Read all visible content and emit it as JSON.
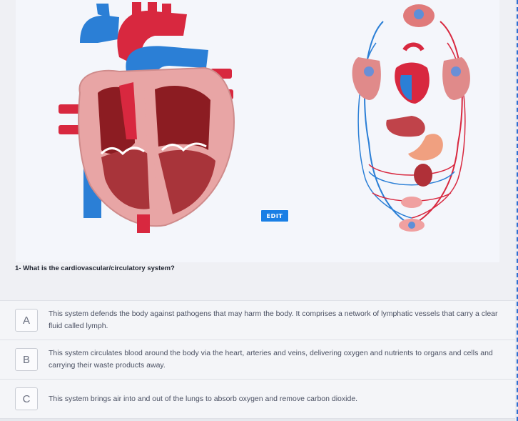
{
  "edit_button": "EDIT",
  "question": "1- What is the cardiovascular/circulatory system?",
  "options": [
    {
      "letter": "A",
      "text": "This system defends the body against pathogens that may harm the body. It comprises a network of lymphatic vessels that carry a clear fluid called lymph."
    },
    {
      "letter": "B",
      "text": "This system circulates blood around the body via the heart, arteries and veins, delivering oxygen and nutrients to organs and cells and carrying their waste products away."
    },
    {
      "letter": "C",
      "text": "This system brings air into and out of the lungs to absorb oxygen and remove carbon dioxide."
    }
  ],
  "icons": {
    "heart": "heart-anatomy-illustration",
    "circulation": "circulatory-system-illustration"
  },
  "colors": {
    "artery_red": "#d8283f",
    "vein_blue": "#2b7fd6",
    "edit_button": "#1a7fe5",
    "accent_dash": "#2f6fd1"
  }
}
